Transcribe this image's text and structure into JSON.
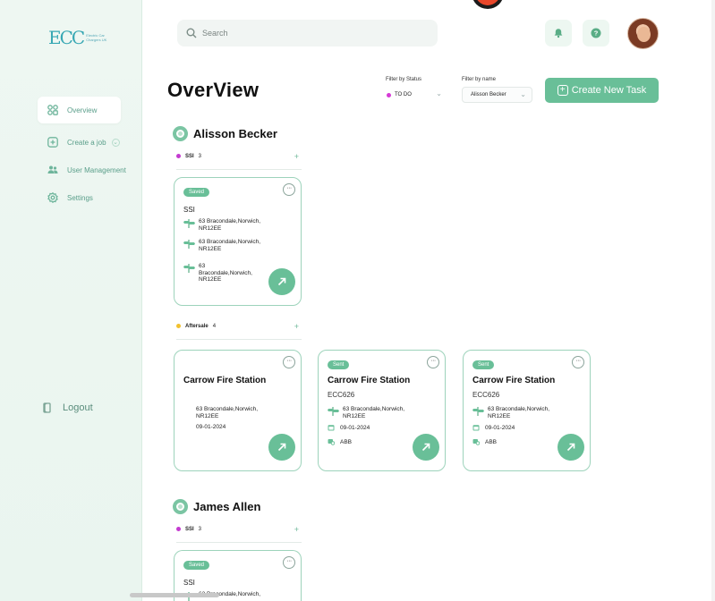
{
  "brand": {
    "logo_text": "ECC",
    "logo_sub": "Electric Car Chargers UK"
  },
  "sidebar": {
    "items": [
      {
        "label": "Overview",
        "icon": "grid-icon",
        "active": true
      },
      {
        "label": "Create a job",
        "icon": "plus-square-icon",
        "has_dropdown": true
      },
      {
        "label": "User Management",
        "icon": "users-icon"
      },
      {
        "label": "Settings",
        "icon": "gear-icon"
      }
    ],
    "logout_label": "Logout"
  },
  "header": {
    "search_placeholder": "Search",
    "notification_icon": "bell-icon",
    "help_icon": "question-icon"
  },
  "page": {
    "title": "OverView",
    "filter_status_label": "Filter by Status",
    "filter_status_value": "TO DO",
    "filter_name_label": "Filter by name",
    "filter_name_value": "Alisson Becker",
    "create_button": "Create New Task"
  },
  "colors": {
    "accent": "#69bf98",
    "todo_dot": "#d63ad6",
    "aftersale_dot": "#f2c12e",
    "ssi_dot": "#c43bd0"
  },
  "people": [
    {
      "name": "Alisson Becker",
      "groups": [
        {
          "name": "SSI",
          "count": "3",
          "cards": [
            {
              "badge": "Saved",
              "title": "SSI",
              "addresses": [
                "63 Bracondale,Norwich, NR12EE",
                "63 Bracondale,Norwich, NR12EE",
                "63 Bracondale,Norwich, NR12EE"
              ]
            }
          ]
        },
        {
          "name": "Aftersale",
          "count": "4",
          "cards": [
            {
              "title": "Carrow Fire Station",
              "address": "63 Bracondale,Norwich, NR12EE",
              "date": "09-01-2024"
            },
            {
              "badge": "Sent",
              "title": "Carrow Fire Station",
              "code": "ECC626",
              "address": "63 Bracondale,Norwich, NR12EE",
              "date": "09-01-2024",
              "tag": "ABB"
            },
            {
              "badge": "Sent",
              "title": "Carrow Fire Station",
              "code": "ECC626",
              "address": "63 Bracondale,Norwich, NR12EE",
              "date": "09-01-2024",
              "tag": "ABB"
            }
          ]
        }
      ]
    },
    {
      "name": "James Allen",
      "groups": [
        {
          "name": "SSI",
          "count": "3",
          "cards": [
            {
              "badge": "Saved",
              "title": "SSI",
              "addresses": [
                "63 Bracondale,Norwich,"
              ]
            }
          ]
        }
      ]
    }
  ]
}
